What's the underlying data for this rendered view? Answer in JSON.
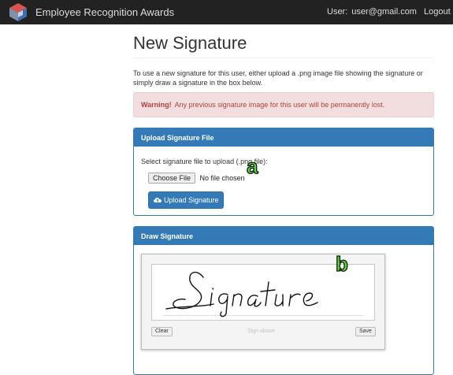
{
  "navbar": {
    "brand": "Employee Recognition Awards",
    "user_label": "User:",
    "user_email": "user@gmail.com",
    "logout_label": "Logout"
  },
  "page": {
    "title": "New Signature",
    "intro": "To use a new signature for this user, either upload a .png image file showing the signature or simply draw a signature in the box below.",
    "alert_strong": "Warning!",
    "alert_text": "Any previous signature image for this user will be permanently lost."
  },
  "upload_panel": {
    "heading": "Upload Signature File",
    "prompt": "Select signature file to upload (.png file):",
    "choose_label": "Choose File",
    "no_file_text": "No file chosen",
    "upload_label": "Upload Signature"
  },
  "draw_panel": {
    "heading": "Draw Signature",
    "clear_label": "Clear",
    "hint": "Sign above",
    "save_label": "Save"
  },
  "annotations": {
    "a": "a",
    "b": "b"
  },
  "colors": {
    "navbar": "#222222",
    "primary": "#337ab7",
    "alert_bg": "#f2dede",
    "alert_text": "#a94442",
    "callout": "#55dd33"
  },
  "icons": {
    "brand": "cube-logo-icon",
    "upload": "cloud-upload-icon"
  }
}
